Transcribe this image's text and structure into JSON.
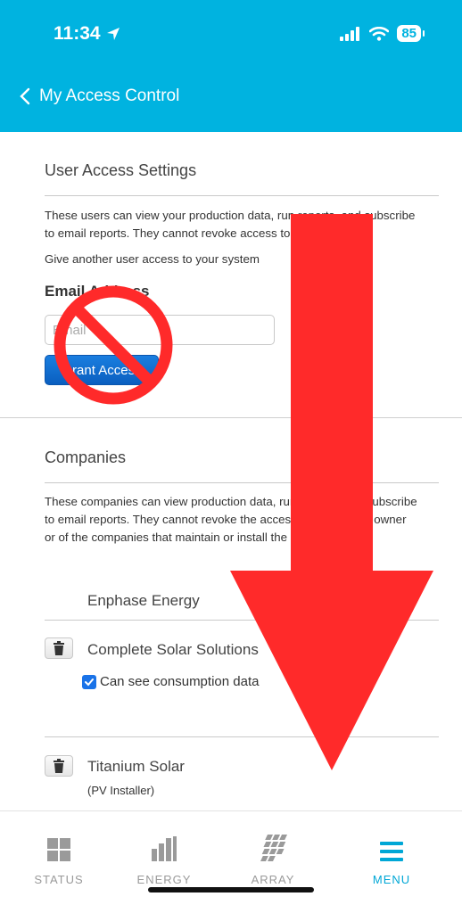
{
  "status_bar": {
    "time": "11:34",
    "battery": "85"
  },
  "header": {
    "back_label": "My Access Control",
    "bg_color": "#00b3e0"
  },
  "user_access": {
    "title": "User Access Settings",
    "description": "These users can view your production data, run reports, and subscribe to email reports. They cannot revoke access to others.",
    "give_access_text": "Give another user access to your system",
    "email_label": "Email Address",
    "email_placeholder": "Email",
    "grant_button": "Grant Access"
  },
  "companies": {
    "title": "Companies",
    "description": "These companies can view production data, run reports, and subscribe to email reports. They cannot revoke the access of the system owner or of the companies that maintain or install the system.",
    "items": [
      {
        "name": "Enphase Energy"
      },
      {
        "name": "Complete Solar Solutions",
        "checkbox_label": "Can see consumption data",
        "checked": true
      },
      {
        "name": "Titanium Solar",
        "role": "(PV Installer)"
      }
    ]
  },
  "tabbar": {
    "tabs": [
      {
        "label": "STATUS",
        "icon": "grid-icon"
      },
      {
        "label": "ENERGY",
        "icon": "bar-chart-icon"
      },
      {
        "label": "ARRAY",
        "icon": "solar-array-icon"
      },
      {
        "label": "MENU",
        "icon": "menu-icon",
        "active": true
      }
    ],
    "active_color": "#00a7d6"
  },
  "overlays": {
    "prohibition_sign": "no-sign-icon",
    "arrow": "down-arrow-icon",
    "color": "#ff2a2a"
  }
}
